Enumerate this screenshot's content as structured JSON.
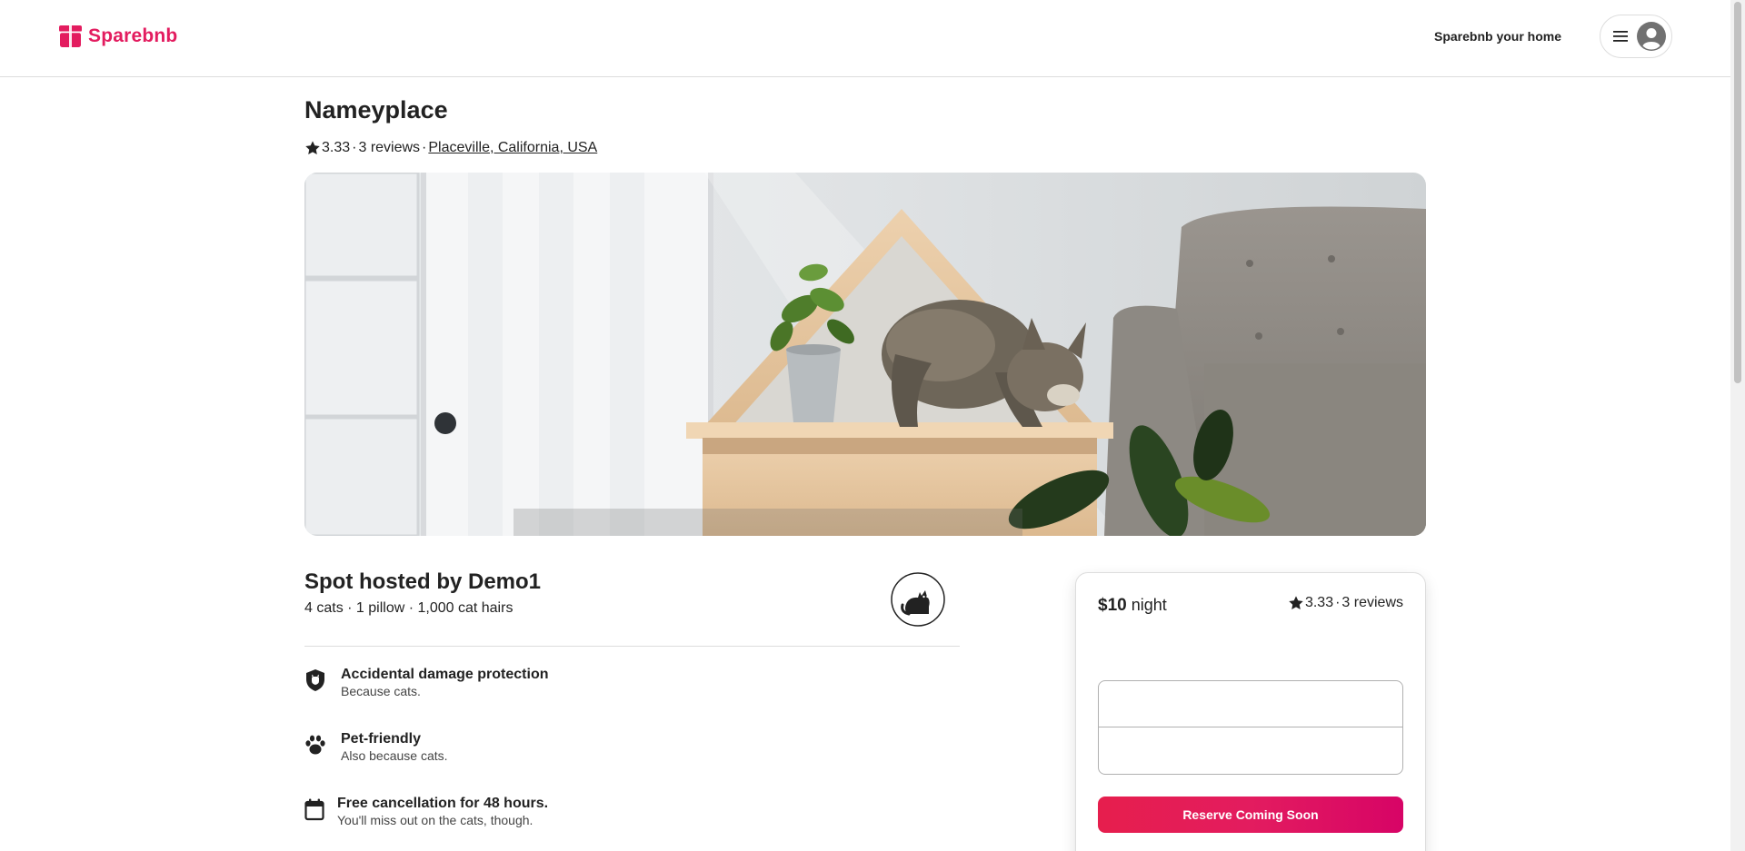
{
  "header": {
    "logo_text": "Sparebnb",
    "logo_icon": "box-icon",
    "host_link": "Sparebnb your home",
    "menu_icon": "hamburger-menu-icon",
    "avatar_icon": "user-avatar-icon"
  },
  "listing": {
    "title": "Nameyplace",
    "rating": "3.33",
    "separator": "·",
    "reviews": "3 reviews",
    "location": "Placeville, California, USA",
    "image_icon": "cat-in-house-photo"
  },
  "host": {
    "title": "Spot hosted by Demo1",
    "stats": "4 cats · 1 pillow · 1,000 cat hairs",
    "avatar_icon": "cat-avatar-icon"
  },
  "features": [
    {
      "icon": "shield-icon",
      "title": "Accidental damage protection",
      "subtitle": "Because cats."
    },
    {
      "icon": "paw-icon",
      "title": "Pet-friendly",
      "subtitle": "Also because cats."
    },
    {
      "icon": "calendar-icon",
      "title": "Free cancellation for 48 hours.",
      "subtitle": "You'll miss out on the cats, though."
    }
  ],
  "booking": {
    "price": "$10",
    "price_unit": " night",
    "rating": "3.33",
    "separator": "·",
    "reviews": "3 reviews",
    "checkin_value": "",
    "checkout_value": "",
    "reserve_label": "Reserve Coming Soon"
  },
  "colors": {
    "brand": "#e31c5f",
    "text": "#222222",
    "border": "#dddddd"
  }
}
